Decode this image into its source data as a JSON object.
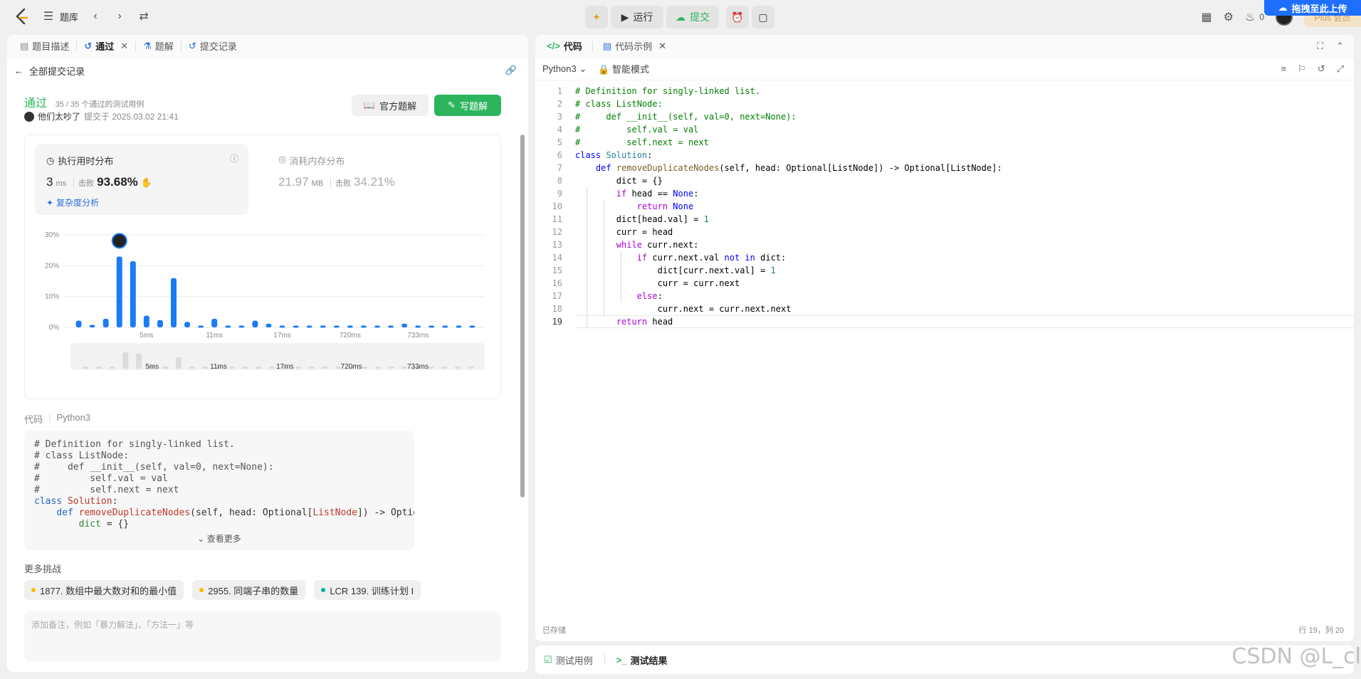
{
  "topbar": {
    "problem_bank": "题库",
    "run": "运行",
    "submit": "提交",
    "fire_count": "0",
    "upload_banner": "拖拽至此上传",
    "vip": "Plus 会员"
  },
  "left": {
    "tabs": [
      "题目描述",
      "通过",
      "题解",
      "提交记录"
    ],
    "back": "全部提交记录",
    "status": "通过",
    "status_meta": "35 / 35 个通过的测试用例",
    "user": "他们太吵了",
    "submitted": "提交于 2025.03.02 21:41",
    "official_solution": "官方题解",
    "write_solution": "写题解",
    "runtime": {
      "title": "执行用时分布",
      "value": "3",
      "unit": "ms",
      "beat_label": "击败",
      "beat": "93.68%",
      "complexity": "复杂度分析"
    },
    "memory": {
      "title": "消耗内存分布",
      "value": "21.97",
      "unit": "MB",
      "beat_label": "击败",
      "beat": "34.21%"
    },
    "code_label": "代码",
    "code_lang": "Python3",
    "see_more": "查看更多",
    "more_challenges": "更多挑战",
    "challenges": [
      {
        "label": "1877. 数组中最大数对和的最小值",
        "color": "#ffb800"
      },
      {
        "label": "2955. 同端子串的数量",
        "color": "#ffb800"
      },
      {
        "label": "LCR 139. 训练计划 I",
        "color": "#00af9b"
      }
    ],
    "note_placeholder": "添加备注，例如「暴力解法」、「方法一」等"
  },
  "chart_data": {
    "type": "bar",
    "title": "执行用时分布",
    "ylabel": "",
    "xlabel": "",
    "y_ticks": [
      "30%",
      "20%",
      "10%",
      "0%"
    ],
    "ylim": [
      0,
      30
    ],
    "x_tick_labels": [
      "5ms",
      "11ms",
      "17ms",
      "720ms",
      "733ms"
    ],
    "values": [
      2.2,
      0.8,
      2.8,
      23.0,
      21.5,
      3.8,
      2.4,
      16.0,
      1.8,
      0.6,
      2.8,
      0.6,
      0.6,
      2.2,
      1.2,
      0.6,
      0.6,
      0.6,
      0.6,
      0.6,
      0.6,
      0.6,
      0.6,
      0.6,
      1.2,
      0.6,
      0.6,
      0.6,
      0.6,
      0.6
    ],
    "highlight_index": 3,
    "color": "#1a7cf5"
  },
  "right": {
    "tab_code": "代码",
    "tab_example": "代码示例",
    "lang": "Python3",
    "smart_mode": "智能模式",
    "saved": "已存储",
    "cursor": "行 19，列 20"
  },
  "bottom": {
    "tab_testcase": "测试用例",
    "tab_result": "测试结果"
  },
  "watermark": "CSDN @L_cl"
}
